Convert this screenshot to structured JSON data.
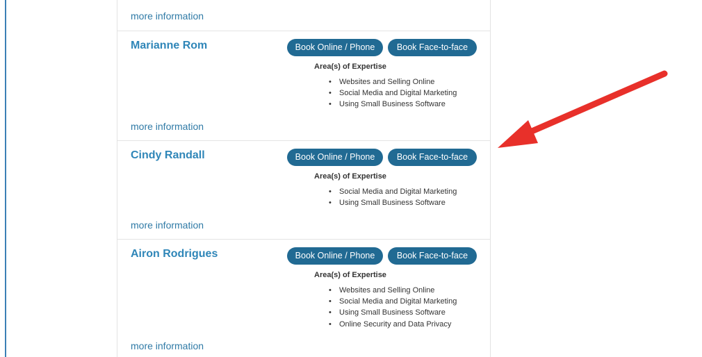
{
  "top_link": "more information",
  "expertise_heading": "Area(s) of Expertise",
  "buttons": {
    "book_phone": "Book Online / Phone",
    "book_face": "Book Face-to-face"
  },
  "advisors": [
    {
      "name": "Marianne Rom",
      "expertise": [
        "Websites and Selling Online",
        "Social Media and Digital Marketing",
        "Using Small Business Software"
      ],
      "more_link": "more information"
    },
    {
      "name": "Cindy Randall",
      "expertise": [
        "Social Media and Digital Marketing",
        "Using Small Business Software"
      ],
      "more_link": "more information"
    },
    {
      "name": "Airon Rodrigues",
      "expertise": [
        "Websites and Selling Online",
        "Social Media and Digital Marketing",
        "Using Small Business Software",
        "Online Security and Data Privacy"
      ],
      "more_link": "more information"
    }
  ],
  "colors": {
    "button_bg": "#216a93",
    "name_link": "#2f86b8",
    "link": "#2f7aa6",
    "annotation_arrow": "#e8302a"
  },
  "annotation": {
    "icon": "red-arrow-icon"
  }
}
